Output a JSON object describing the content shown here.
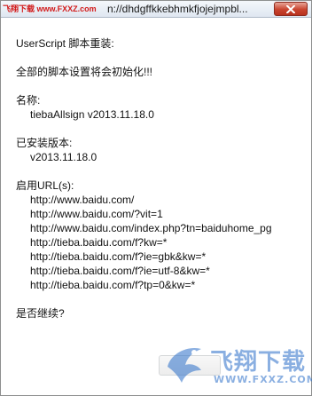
{
  "window": {
    "logo_text": "飞翔下载 www.FXXZ.com",
    "title": "n://dhdgffkkebhmkfjojejmpbl...",
    "close_icon": "close-icon"
  },
  "dialog": {
    "header": "UserScript 脚本重装:",
    "warning": "全部的脚本设置将会初始化!!!",
    "name_label": "名称:",
    "name_value": "tiebaAllsign v2013.11.18.0",
    "installed_label": "已安装版本:",
    "installed_value": "v2013.11.18.0",
    "urls_label": "启用URL(s):",
    "urls": [
      "http://www.baidu.com/",
      "http://www.baidu.com/?vit=1",
      "http://www.baidu.com/index.php?tn=baiduhome_pg",
      "http://tieba.baidu.com/f?kw=*",
      "http://tieba.baidu.com/f?ie=gbk&kw=*",
      "http://tieba.baidu.com/f?ie=utf-8&kw=*",
      "http://tieba.baidu.com/f?tp=0&kw=*"
    ],
    "confirm": "是否继续?"
  },
  "watermark": {
    "brand": "飞翔下载",
    "url": "WWW.FXXZ.COM"
  },
  "colors": {
    "close_button": "#c9442f",
    "watermark": "#2b6fc9",
    "logo": "#d21a1a"
  }
}
